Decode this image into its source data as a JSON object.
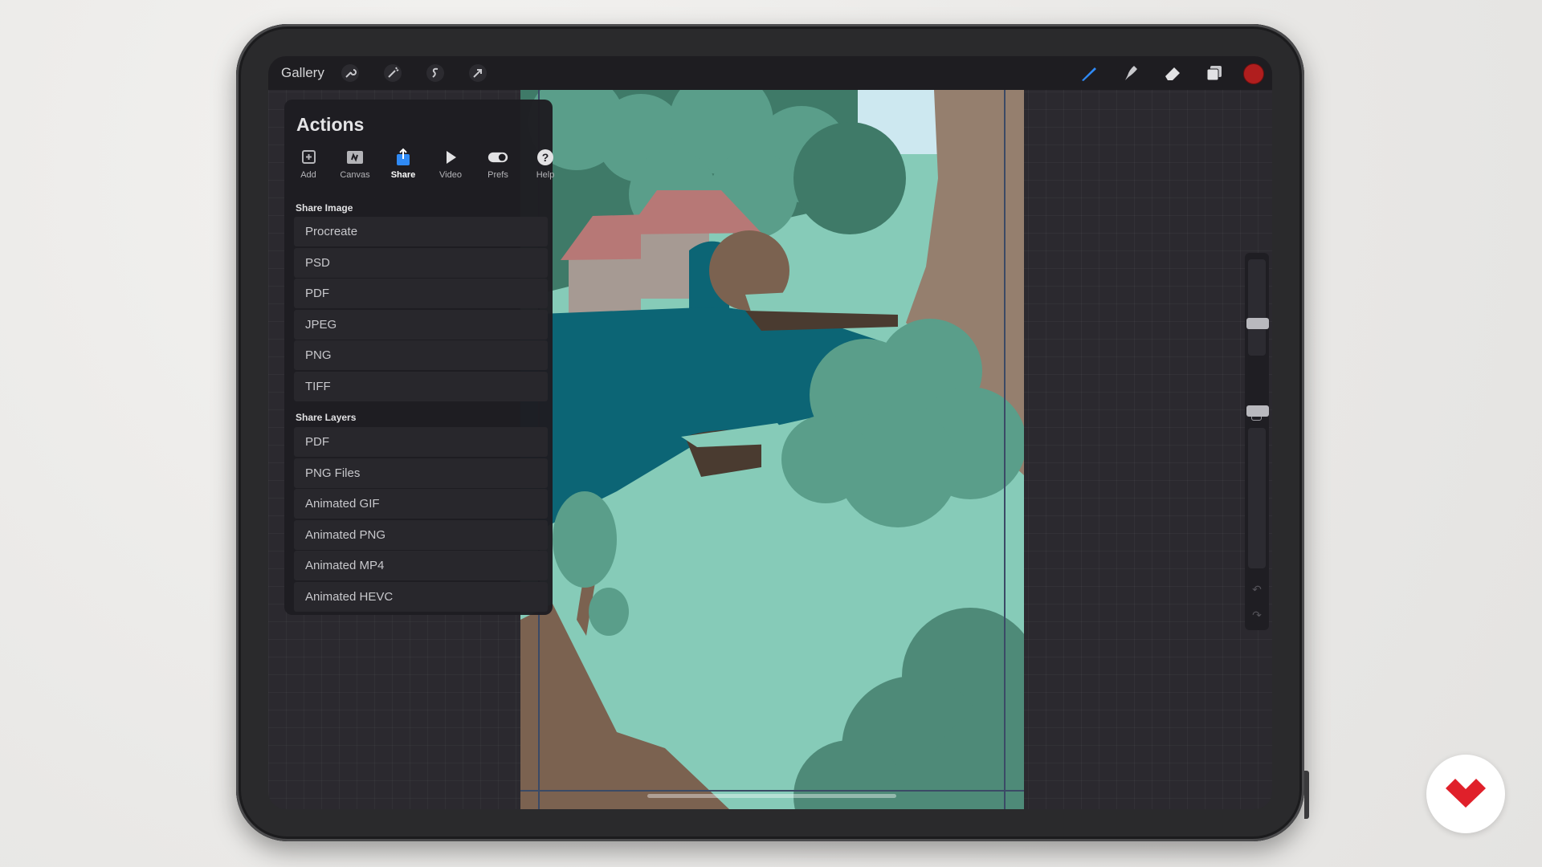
{
  "toolbar": {
    "gallery_label": "Gallery",
    "left_icons": [
      "wrench-icon",
      "magic-wand-icon",
      "selection-icon",
      "transform-arrow-icon"
    ],
    "right_icons": [
      "brush-icon",
      "smudge-icon",
      "eraser-icon",
      "layers-icon"
    ],
    "active_color": "#b01e1e"
  },
  "actions_panel": {
    "title": "Actions",
    "tabs": [
      {
        "label": "Add",
        "icon": "add-icon"
      },
      {
        "label": "Canvas",
        "icon": "canvas-icon"
      },
      {
        "label": "Share",
        "icon": "share-icon",
        "active": true
      },
      {
        "label": "Video",
        "icon": "play-icon"
      },
      {
        "label": "Prefs",
        "icon": "toggle-icon"
      },
      {
        "label": "Help",
        "icon": "help-icon"
      }
    ],
    "share_image": {
      "heading": "Share Image",
      "items": [
        "Procreate",
        "PSD",
        "PDF",
        "JPEG",
        "PNG",
        "TIFF"
      ]
    },
    "share_layers": {
      "heading": "Share Layers",
      "items": [
        "PDF",
        "PNG Files",
        "Animated GIF",
        "Animated PNG",
        "Animated MP4",
        "Animated HEVC"
      ]
    }
  },
  "sidebar": {
    "brush_size_level": 0.62,
    "opacity_level": 0.15,
    "undo_icon": "undo-icon",
    "redo_icon": "redo-icon"
  },
  "colors": {
    "accent": "#2f8af5",
    "panel_bg": "#1e1d22",
    "canvas_water": "#0c6575",
    "canvas_grass": "#86cbb8",
    "canvas_trees": "#5a9e8a",
    "canvas_trunk": "#957f6e"
  },
  "watermark": "domestika-logo"
}
